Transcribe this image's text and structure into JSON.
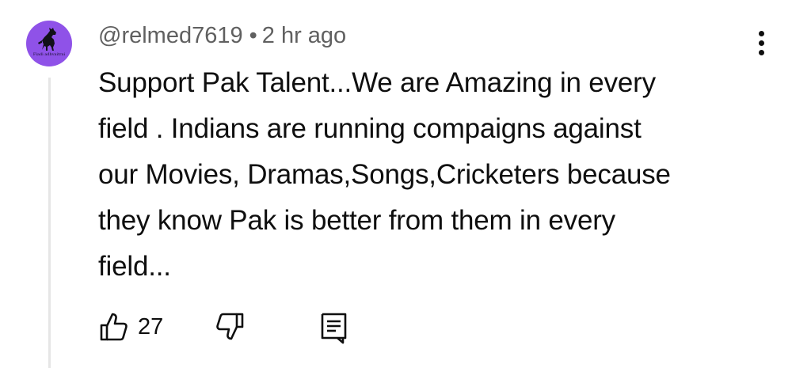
{
  "avatar": {
    "icon": "horse-silhouette-icon",
    "caption": "Fiadi adhvaitrai",
    "background": "#8f52e8"
  },
  "comment": {
    "author": "@relmed7619",
    "separator": "•",
    "time": "2 hr ago",
    "text_lines": [
      "Support Pak Talent...We are Amazing in every",
      "field . Indians are running compaigns against",
      "our Movies, Dramas,Songs,Cricketers because",
      "they know Pak is better from them in every",
      "field..."
    ]
  },
  "actions": {
    "like_icon": "thumbs-up-icon",
    "like_count": "27",
    "dislike_icon": "thumbs-down-icon",
    "reply_icon": "reply-comment-icon"
  },
  "menu": {
    "icon": "more-vertical-icon"
  }
}
